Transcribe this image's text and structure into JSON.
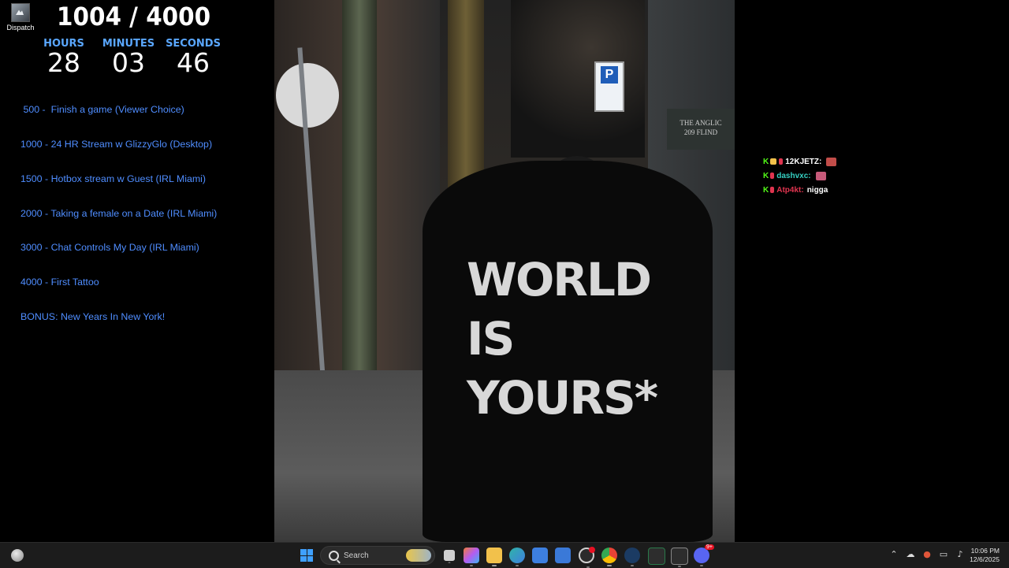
{
  "desktop": {
    "icons": [
      {
        "label": "Dispatch"
      }
    ]
  },
  "overlay": {
    "goal_count": "1004 / 4000",
    "timer": {
      "hours_label": "HOURS",
      "minutes_label": "MINUTES",
      "seconds_label": "SECONDS",
      "hours": "28",
      "minutes": "03",
      "seconds": "46"
    },
    "goals": [
      " 500 -  Finish a game (Viewer Choice)",
      "1000 - 24 HR Stream w GlizzyGlo (Desktop)",
      "1500 - Hotbox stream w Guest (IRL Miami)",
      "2000 - Taking a female on a Date (IRL Miami)",
      "3000 - Chat Controls My Day (IRL Miami)",
      "4000 - First Tattoo",
      "BONUS: New Years In New York!"
    ]
  },
  "video": {
    "parking_sign": "P",
    "building_sign": [
      "THE ANGLIC",
      "209 FLIND"
    ],
    "shirt_print": [
      "WORLD",
      "IS",
      "YOURS*"
    ]
  },
  "chat": {
    "platform_badge": "K",
    "messages": [
      {
        "user": "12KJETZ:",
        "text": "",
        "user_color": "#ffffff",
        "emote": "emote"
      },
      {
        "user": "dashvxc:",
        "text": "",
        "user_color": "#35d0c2",
        "emote": "emote"
      },
      {
        "user": "Atp4kt:",
        "text": "nigga",
        "user_color": "#e0344f",
        "emote": ""
      }
    ]
  },
  "taskbar": {
    "search_placeholder": "Search",
    "time": "10:06 PM",
    "date": "12/6/2025",
    "apps": [
      {
        "name": "task-view",
        "color": "#d0d0d0"
      },
      {
        "name": "copilot",
        "color": "#b45cf2"
      },
      {
        "name": "file-explorer",
        "color": "#f2c14b"
      },
      {
        "name": "edge",
        "color": "#2fb4a8"
      },
      {
        "name": "store",
        "color": "#3d7fe0"
      },
      {
        "name": "mail",
        "color": "#3a79d8"
      },
      {
        "name": "clock-app",
        "color": "#cfcfcf"
      },
      {
        "name": "chrome",
        "color": "#e8b730"
      },
      {
        "name": "steam",
        "color": "#1b3b63"
      },
      {
        "name": "xbox",
        "color": "#2a7a4a"
      },
      {
        "name": "epic-games",
        "color": "#2d2d2d"
      },
      {
        "name": "discord",
        "color": "#5865f2"
      }
    ],
    "discord_badge": "9+"
  }
}
